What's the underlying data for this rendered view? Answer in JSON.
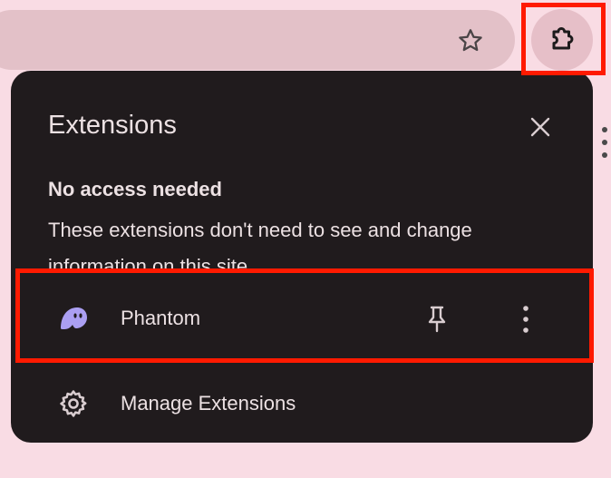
{
  "toolbar": {
    "bookmark_icon": "star-outline-icon",
    "extensions_icon": "puzzle-piece-icon"
  },
  "panel": {
    "title": "Extensions",
    "close_icon": "close-icon",
    "section": {
      "heading": "No access needed",
      "description": "These extensions don't need to see and change information on this site."
    },
    "extensions": [
      {
        "name": "Phantom",
        "icon": "phantom-ghost-icon",
        "pin_icon": "pin-icon",
        "menu_icon": "more-vertical-icon"
      }
    ],
    "manage": {
      "label": "Manage Extensions",
      "icon": "gear-icon"
    }
  },
  "colors": {
    "page_bg": "#f9dce4",
    "omnibox_bg": "#e3c1c8",
    "panel_bg": "#201b1d",
    "text": "#ece1e3",
    "highlight": "#ff1a00",
    "phantom_purple": "#ab9ff2"
  }
}
